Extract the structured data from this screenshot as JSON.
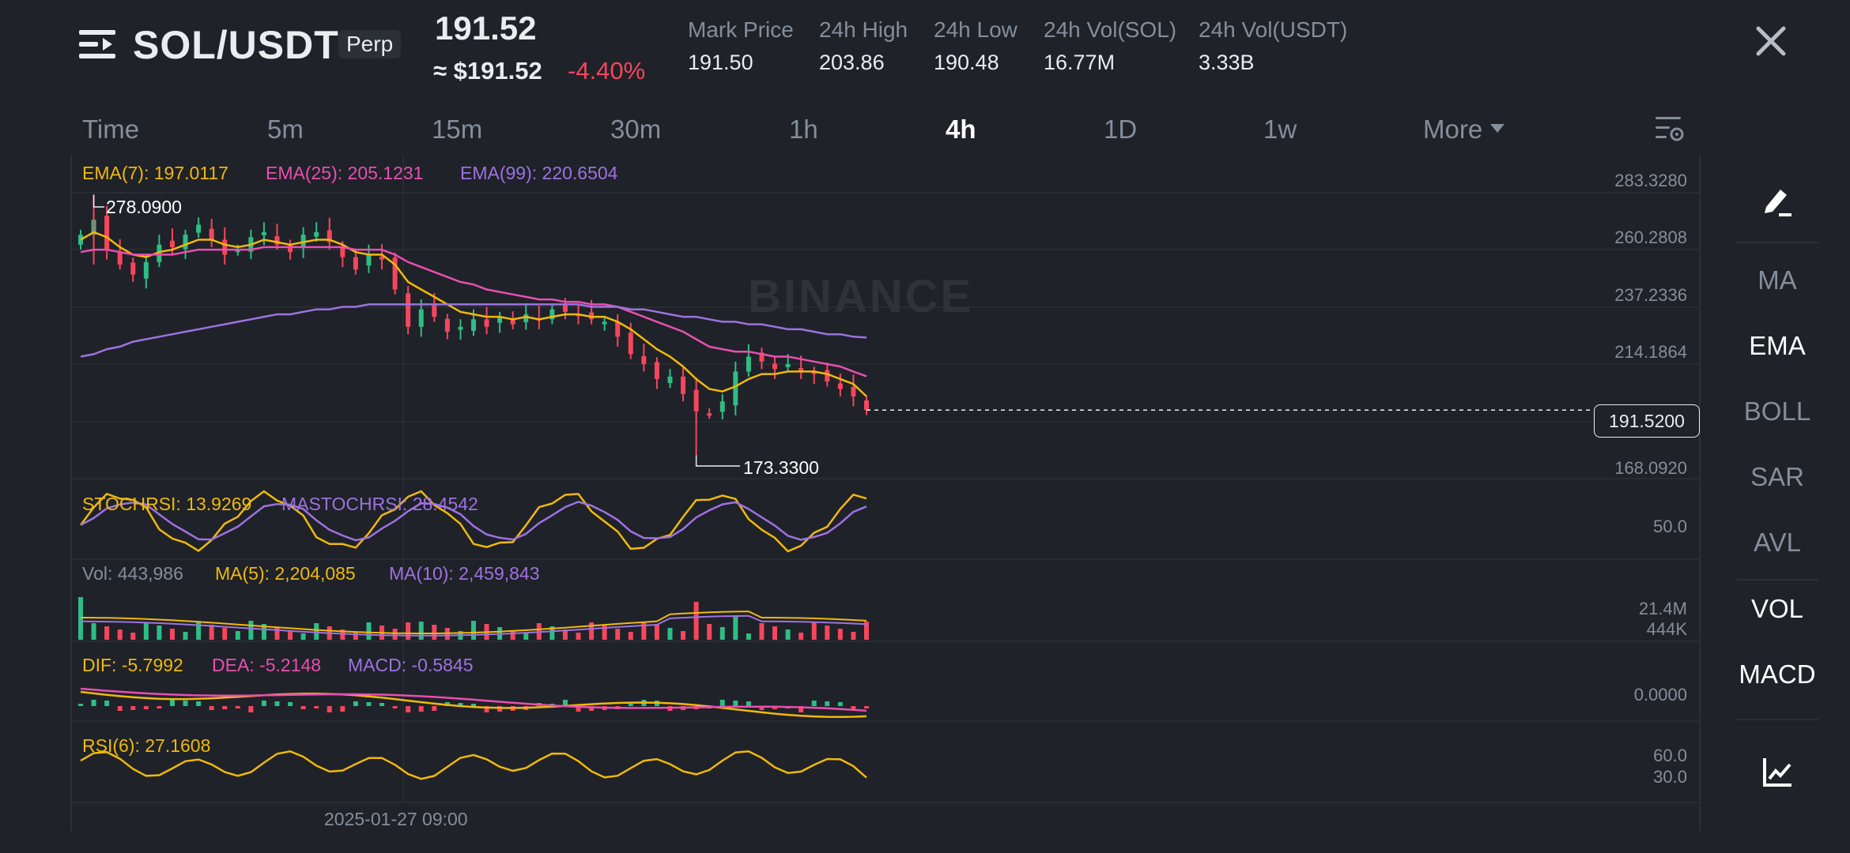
{
  "header": {
    "pair": "SOL/USDT",
    "contract_type": "Perp",
    "last_price": "191.52",
    "price_usd": "≈ $191.52",
    "change_pct": "-4.40%",
    "stats": [
      {
        "label": "Mark Price",
        "value": "191.50"
      },
      {
        "label": "24h High",
        "value": "203.86"
      },
      {
        "label": "24h Low",
        "value": "190.48"
      },
      {
        "label": "24h Vol(SOL)",
        "value": "16.77M"
      },
      {
        "label": "24h Vol(USDT)",
        "value": "3.33B"
      }
    ]
  },
  "timeframes": {
    "items": [
      "Time",
      "5m",
      "15m",
      "30m",
      "1h",
      "4h",
      "1D",
      "1w",
      "More"
    ],
    "active": "4h"
  },
  "indicators": {
    "ema7": "EMA(7): 197.0117",
    "ema25": "EMA(25): 205.1231",
    "ema99": "EMA(99): 220.6504",
    "stochrsi": "STOCHRSI: 13.9269",
    "mastochrsi": "MASTOCHRSI: 28.4542",
    "vol": "Vol: 443,986",
    "vol_ma5": "MA(5): 2,204,085",
    "vol_ma10": "MA(10): 2,459,843",
    "dif": "DIF: -5.7992",
    "dea": "DEA: -5.2148",
    "macd": "MACD: -0.5845",
    "rsi6": "RSI(6): 27.1608"
  },
  "price_axis": [
    "283.3280",
    "260.2808",
    "237.2336",
    "214.1864",
    "168.0920"
  ],
  "current_price_label": "191.5200",
  "high_marker": "278.0900",
  "low_marker": "173.3300",
  "watermark": "BINANCE",
  "stoch_axis": "50.0",
  "vol_axis": [
    "21.4M",
    "444K"
  ],
  "macd_axis": "0.0000",
  "rsi_axis": [
    "60.0",
    "30.0"
  ],
  "date_label": "2025-01-27 09:00",
  "side_panel": {
    "items": [
      "MA",
      "EMA",
      "BOLL",
      "SAR",
      "AVL",
      "VOL",
      "MACD"
    ],
    "active": [
      "EMA",
      "VOL",
      "MACD"
    ]
  },
  "colors": {
    "up": "#2ebd85",
    "down": "#f6465d",
    "ema7": "#f0b90b",
    "ema25": "#e84fb0",
    "ema99": "#9d72e0",
    "text_dim": "#848e9c"
  },
  "chart_data": {
    "type": "line",
    "title": "",
    "xlabel": "",
    "ylabel": "",
    "ylim": [
      168.092,
      283.328
    ],
    "close": [
      262,
      268,
      256,
      250,
      246,
      251,
      258,
      257,
      262,
      266,
      260,
      254,
      256,
      261,
      263,
      258,
      255,
      262,
      263,
      259,
      253,
      248,
      254,
      252,
      240,
      225,
      232,
      229,
      223,
      225,
      228,
      225,
      229,
      226,
      230,
      228,
      232,
      231,
      230,
      228,
      227,
      221,
      214,
      210,
      204,
      205,
      198,
      191,
      190,
      195,
      207,
      213,
      211,
      208,
      210,
      207,
      206,
      203,
      200,
      197,
      191.52
    ],
    "series": [
      {
        "name": "EMA(7)",
        "values": [
          260,
          263,
          261,
          257,
          254,
          253,
          255,
          256,
          258,
          260,
          260,
          258,
          257,
          258,
          260,
          259,
          258,
          259,
          260,
          260,
          258,
          255,
          254,
          254,
          250,
          243,
          240,
          237,
          234,
          231,
          230,
          229,
          229,
          228,
          229,
          228,
          229,
          230,
          230,
          229,
          229,
          227,
          224,
          220,
          216,
          213,
          209,
          204,
          200,
          199,
          201,
          204,
          206,
          206,
          207,
          207,
          207,
          206,
          204,
          202,
          197.01
        ]
      },
      {
        "name": "EMA(25)",
        "values": [
          255,
          256,
          256,
          255,
          254,
          254,
          254,
          254,
          255,
          256,
          256,
          256,
          256,
          256,
          257,
          257,
          257,
          257,
          257,
          257,
          257,
          256,
          256,
          256,
          254,
          251,
          249,
          247,
          245,
          243,
          242,
          240,
          239,
          238,
          237,
          236,
          236,
          235,
          235,
          234,
          234,
          233,
          231,
          229,
          227,
          225,
          223,
          220,
          217,
          216,
          215,
          215,
          214,
          213,
          213,
          212,
          211,
          210,
          209,
          207,
          205.12
        ]
      },
      {
        "name": "EMA(99)",
        "values": [
          213,
          214,
          216,
          217,
          219,
          220,
          221,
          222,
          223,
          224,
          225,
          226,
          227,
          228,
          229,
          230,
          230,
          231,
          232,
          232,
          233,
          233,
          234,
          234,
          234,
          234,
          234,
          234,
          234,
          234,
          234,
          234,
          234,
          234,
          234,
          234,
          234,
          234,
          234,
          233,
          233,
          233,
          232,
          232,
          231,
          230,
          229,
          229,
          228,
          227,
          227,
          226,
          226,
          225,
          224,
          224,
          223,
          222,
          222,
          221,
          220.65
        ]
      }
    ],
    "volume_ma_note": "",
    "rsi6_last": 27.1608
  }
}
